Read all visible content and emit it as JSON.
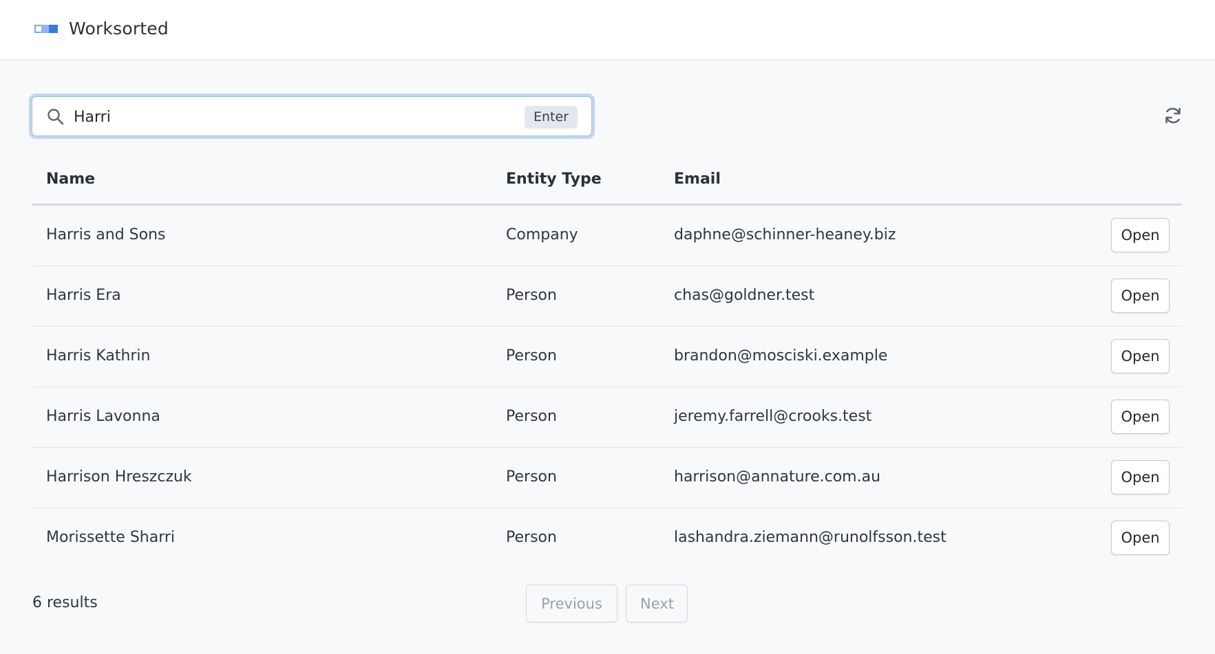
{
  "app": {
    "title": "Worksorted",
    "logo_icon": "worksorted-logo-icon"
  },
  "search": {
    "value": "Harri",
    "placeholder": "",
    "enter_label": "Enter",
    "icon": "search-icon"
  },
  "toolbar": {
    "refresh_icon": "refresh-icon"
  },
  "table": {
    "columns": [
      "Name",
      "Entity Type",
      "Email"
    ],
    "rows": [
      {
        "name": "Harris and Sons",
        "type": "Company",
        "email": "daphne@schinner-heaney.biz",
        "action": "Open"
      },
      {
        "name": "Harris Era",
        "type": "Person",
        "email": "chas@goldner.test",
        "action": "Open"
      },
      {
        "name": "Harris Kathrin",
        "type": "Person",
        "email": "brandon@mosciski.example",
        "action": "Open"
      },
      {
        "name": "Harris Lavonna",
        "type": "Person",
        "email": "jeremy.farrell@crooks.test",
        "action": "Open"
      },
      {
        "name": "Harrison Hreszczuk",
        "type": "Person",
        "email": "harrison@annature.com.au",
        "action": "Open"
      },
      {
        "name": "Morissette Sharri",
        "type": "Person",
        "email": "lashandra.ziemann@runolfsson.test",
        "action": "Open"
      }
    ]
  },
  "footer": {
    "results": "6 results",
    "previous_label": "Previous",
    "next_label": "Next"
  },
  "colors": {
    "accent": "#3a7bd5",
    "focus_ring": "#c3d6ec",
    "background": "#f8f9fb"
  }
}
